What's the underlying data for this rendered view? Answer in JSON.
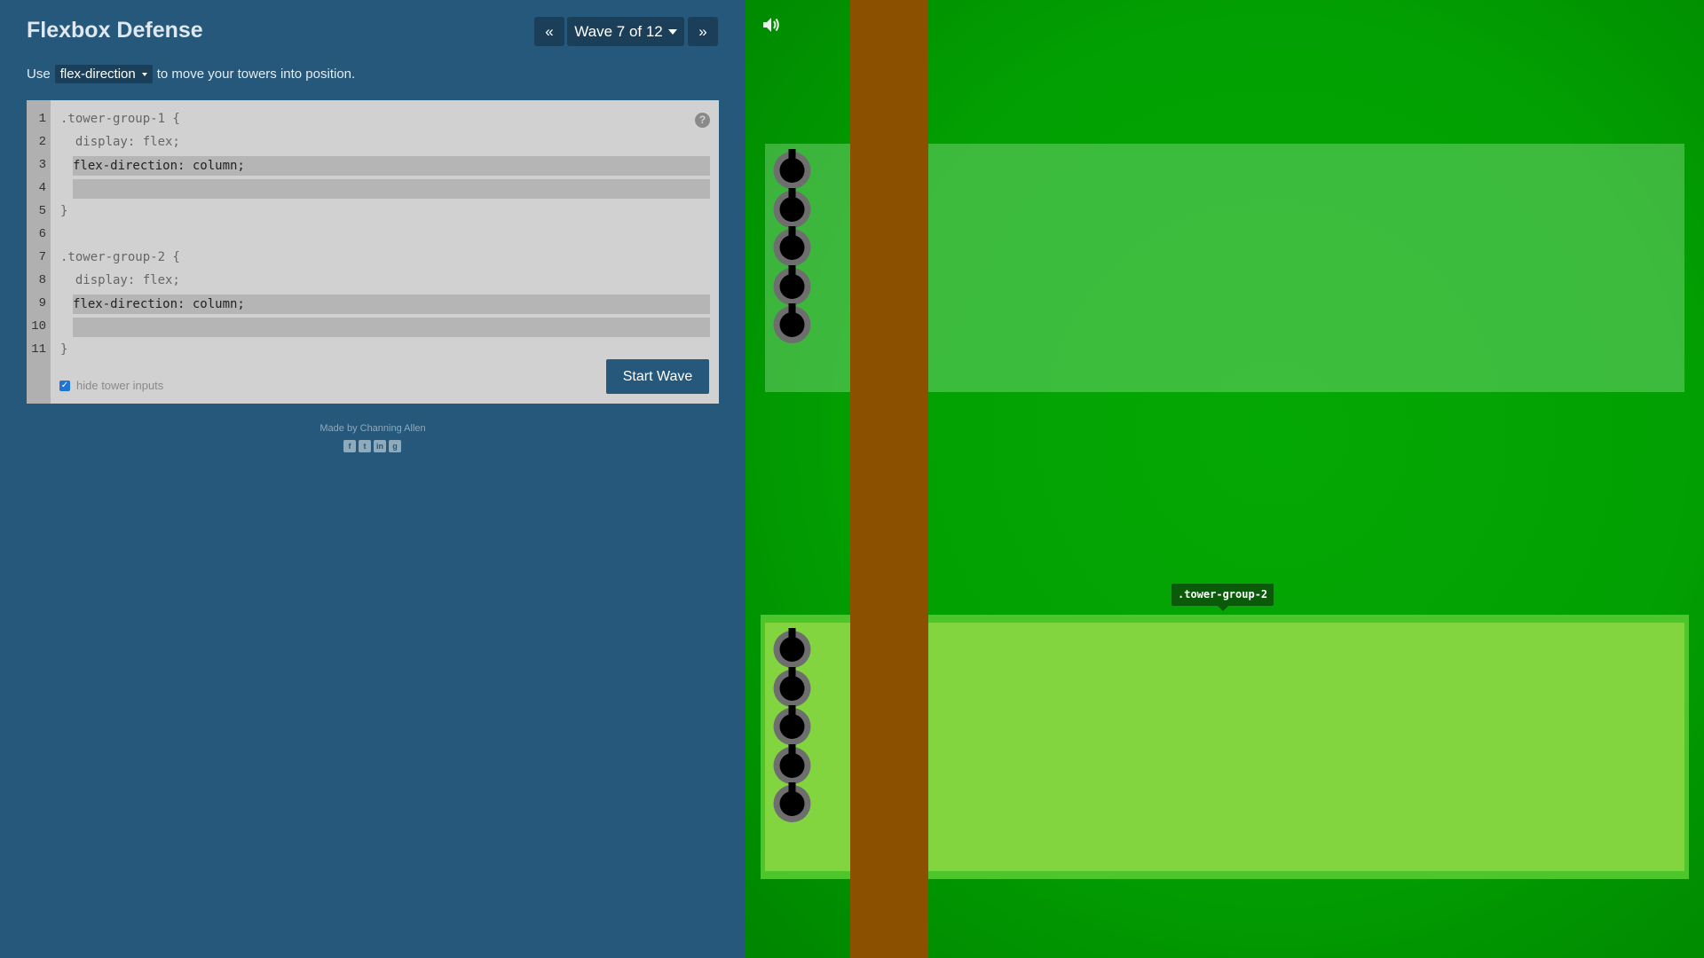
{
  "header": {
    "title": "Flexbox Defense",
    "prev_label": "«",
    "wave_label": "Wave 7 of 12",
    "next_label": "»"
  },
  "instruction": {
    "before": "Use",
    "property": "flex-direction",
    "after": "to move your towers into position."
  },
  "editor": {
    "line_numbers": [
      "1",
      "2",
      "3",
      "4",
      "5",
      "6",
      "7",
      "8",
      "9",
      "10",
      "11"
    ],
    "lines": {
      "l1": ".tower-group-1 {",
      "l2": "  display: flex;",
      "l3_input": "flex-direction: column;",
      "l4_input": "",
      "l5": "}",
      "l7": ".tower-group-2 {",
      "l8": "  display: flex;",
      "l9_input": "flex-direction: column;",
      "l10_input": "",
      "l11": "}"
    },
    "help_label": "?",
    "hide_inputs_label": "hide tower inputs",
    "hide_inputs_checked": true,
    "start_button": "Start Wave"
  },
  "footer": {
    "credits": "Made by Channing Allen",
    "social_icons": [
      "facebook-icon",
      "twitter-icon",
      "linkedin-icon",
      "github-icon"
    ]
  },
  "game": {
    "group_label": ".tower-group-2",
    "group1_towers": 5,
    "group2_towers": 5,
    "colors": {
      "grass": "#02a002",
      "path": "#8b5000",
      "panel": "#25587a",
      "button": "#1b3f58"
    }
  }
}
